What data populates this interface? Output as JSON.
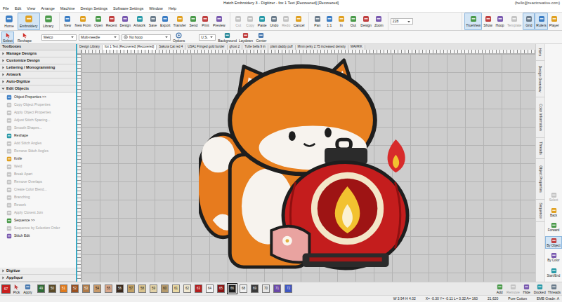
{
  "window": {
    "title": "Hatch Embroidery 3 - Digitizer - fox 1 Text [Recovered] [Recovered]",
    "account": "(hello@reactcreative.com)"
  },
  "menu": [
    "File",
    "Edit",
    "View",
    "Arrange",
    "Machine",
    "Design Settings",
    "Software Settings",
    "Window",
    "Help"
  ],
  "ribbon": {
    "modes": [
      {
        "label": "Home",
        "selected": false
      },
      {
        "label": "Embroidery",
        "selected": true
      },
      {
        "label": "Library",
        "selected": false
      }
    ],
    "groups": [
      [
        {
          "label": "New",
          "selected": false,
          "disabled": false
        },
        {
          "label": "New From",
          "selected": false,
          "disabled": false
        },
        {
          "label": "Open",
          "selected": false,
          "disabled": false
        },
        {
          "label": "Recent",
          "selected": false,
          "disabled": false
        },
        {
          "label": "Design",
          "selected": false,
          "disabled": false
        },
        {
          "label": "Artwork",
          "selected": false,
          "disabled": false
        },
        {
          "label": "Save",
          "selected": false,
          "disabled": false
        },
        {
          "label": "Export",
          "selected": false,
          "disabled": false
        },
        {
          "label": "Transfer",
          "selected": false,
          "disabled": false
        },
        {
          "label": "Send",
          "selected": false,
          "disabled": false
        },
        {
          "label": "Print",
          "selected": false,
          "disabled": false
        },
        {
          "label": "Preview",
          "selected": false,
          "disabled": false
        }
      ],
      [
        {
          "label": "Cut",
          "selected": false,
          "disabled": true
        },
        {
          "label": "Copy",
          "selected": false,
          "disabled": true
        },
        {
          "label": "Paste",
          "selected": false,
          "disabled": false
        },
        {
          "label": "Undo",
          "selected": false,
          "disabled": false
        },
        {
          "label": "Redo",
          "selected": false,
          "disabled": true
        },
        {
          "label": "Cancel",
          "selected": false,
          "disabled": false
        }
      ],
      [
        {
          "label": "Pan",
          "selected": false,
          "disabled": false
        },
        {
          "label": "1:1",
          "selected": false,
          "disabled": false
        },
        {
          "label": "In",
          "selected": false,
          "disabled": false
        },
        {
          "label": "Out",
          "selected": false,
          "disabled": false
        },
        {
          "label": "Design",
          "selected": false,
          "disabled": false
        },
        {
          "label": "Zoom",
          "selected": false,
          "disabled": false
        }
      ]
    ],
    "zoom": "228",
    "display": [
      {
        "label": "TrueView",
        "selected": true,
        "disabled": false
      },
      {
        "label": "Show",
        "selected": false,
        "disabled": false
      },
      {
        "label": "Hoop",
        "selected": false,
        "disabled": false
      },
      {
        "label": "Template",
        "selected": false,
        "disabled": true
      },
      {
        "label": "Grid",
        "selected": true,
        "disabled": false
      },
      {
        "label": "Rulers",
        "selected": true,
        "disabled": false
      },
      {
        "label": "Player",
        "selected": false,
        "disabled": false
      }
    ]
  },
  "toolbar": {
    "tools": [
      {
        "label": "Select",
        "selected": true
      },
      {
        "label": "Reshape",
        "selected": false
      }
    ],
    "machine": "Melco",
    "needle": "Multi-needle",
    "hoop": "No hoop",
    "options": "Options",
    "units": "U.S.",
    "view_tools": [
      "Background",
      "Laydown",
      "Center"
    ]
  },
  "doc_tabs": [
    {
      "label": "Design Library",
      "selected": false
    },
    {
      "label": "fox 1 Text [Recovered] [Recovered]",
      "selected": true
    },
    {
      "label": "Sakura Cat red 4",
      "selected": false
    },
    {
      "label": "USA1 Fringed gold border",
      "selected": false
    },
    {
      "label": "ghost 2",
      "selected": false
    },
    {
      "label": "Tufte bella 9 in",
      "selected": false
    },
    {
      "label": "plant daddy puff",
      "selected": false
    },
    {
      "label": "Mmm jerky 2.75 increased density",
      "selected": false
    },
    {
      "label": "MAVRIK",
      "selected": false
    }
  ],
  "toolbox": {
    "title": "Toolboxes",
    "sections": [
      {
        "label": "Manage Designs",
        "expanded": false,
        "items": []
      },
      {
        "label": "Customize Design",
        "expanded": false,
        "items": []
      },
      {
        "label": "Lettering / Monogramming",
        "expanded": false,
        "items": []
      },
      {
        "label": "Artwork",
        "expanded": false,
        "items": []
      },
      {
        "label": "Auto-Digitize",
        "expanded": false,
        "items": []
      },
      {
        "label": "Edit Objects",
        "expanded": true,
        "items": [
          {
            "label": "Object Properties >>",
            "disabled": false
          },
          {
            "label": "Copy Object Properties",
            "disabled": true
          },
          {
            "label": "Apply Object Properties",
            "disabled": true
          },
          {
            "label": "Adjust Stitch Spacing...",
            "disabled": true
          },
          {
            "label": "Smooth Shapes...",
            "disabled": true
          },
          {
            "label": "Reshape",
            "disabled": false
          },
          {
            "label": "Add Stitch Angles",
            "disabled": true
          },
          {
            "label": "Remove Stitch Angles",
            "disabled": true
          },
          {
            "label": "Knife",
            "disabled": false
          },
          {
            "label": "Weld",
            "disabled": true
          },
          {
            "label": "Break Apart",
            "disabled": true
          },
          {
            "label": "Remove Overlaps",
            "disabled": true
          },
          {
            "label": "Create Color Blend...",
            "disabled": true
          },
          {
            "label": "Branching",
            "disabled": true
          },
          {
            "label": "Rework",
            "disabled": true
          },
          {
            "label": "Apply Closest Join",
            "disabled": true
          },
          {
            "label": "Sequence >>",
            "disabled": false
          },
          {
            "label": "Sequence by Selection Order",
            "disabled": true
          },
          {
            "label": "Stitch Edit",
            "disabled": false
          }
        ]
      },
      {
        "label": "Digitize",
        "expanded": false,
        "items": []
      },
      {
        "label": "Appliqué",
        "expanded": false,
        "items": []
      }
    ]
  },
  "side_tabs": [
    "Hints",
    "Design Overview",
    "Color Information",
    "Threads",
    "Object Properties",
    "Sequence"
  ],
  "side_tools": [
    {
      "label": "Select",
      "selected": false,
      "disabled": true
    },
    {
      "label": "Back",
      "selected": false,
      "disabled": false
    },
    {
      "label": "Forward",
      "selected": false,
      "disabled": false
    },
    {
      "label": "By Object",
      "selected": true,
      "disabled": false
    },
    {
      "label": "By Color",
      "selected": false,
      "disabled": false
    },
    {
      "label": "Start/End",
      "selected": false,
      "disabled": false
    }
  ],
  "palette": {
    "current": {
      "label": "67",
      "color": "#c8201e"
    },
    "tools": [
      "Pick",
      "Apply"
    ],
    "swatches": [
      {
        "label": "49",
        "color": "#2f6a35",
        "selected": false
      },
      {
        "label": "50",
        "color": "#5a4a26",
        "selected": false
      },
      {
        "label": "51",
        "color": "#e07a1c",
        "selected": false
      },
      {
        "label": "52",
        "color": "#9a4f1e",
        "selected": false
      },
      {
        "label": "53",
        "color": "#b07a48",
        "selected": false
      },
      {
        "label": "54",
        "color": "#c89a6a",
        "selected": false
      },
      {
        "label": "55",
        "color": "#d9a88c",
        "selected": false
      },
      {
        "label": "56",
        "color": "#3b2a1e",
        "selected": false
      },
      {
        "label": "57",
        "color": "#c3a266",
        "selected": false
      },
      {
        "label": "58",
        "color": "#d9c38e",
        "selected": false
      },
      {
        "label": "59",
        "color": "#e3d3a8",
        "selected": false
      },
      {
        "label": "60",
        "color": "#b59a6c",
        "selected": false
      },
      {
        "label": "61",
        "color": "#ead9a4",
        "selected": false
      },
      {
        "label": "62",
        "color": "#f1e9d2",
        "selected": false
      },
      {
        "label": "63",
        "color": "#b51d1d",
        "selected": false
      },
      {
        "label": "64",
        "color": "#f5f5f5",
        "selected": false
      },
      {
        "label": "65",
        "color": "#8a1212",
        "selected": false
      },
      {
        "label": "66",
        "color": "#1c1c1c",
        "selected": true
      },
      {
        "label": "68",
        "color": "#f2f2f2",
        "selected": false
      },
      {
        "label": "69",
        "color": "#3a3a3a",
        "selected": false
      },
      {
        "label": "70",
        "color": "#e6e6e6",
        "selected": false
      },
      {
        "label": "71",
        "color": "#6a48a8",
        "selected": false
      },
      {
        "label": "72",
        "color": "#3f56c2",
        "selected": false
      }
    ],
    "actions": [
      {
        "label": "Add",
        "disabled": false
      },
      {
        "label": "Remove",
        "disabled": true
      },
      {
        "label": "Hide",
        "disabled": false
      },
      {
        "label": "Docked",
        "disabled": false
      },
      {
        "label": "Threads",
        "disabled": false
      }
    ]
  },
  "status_bar": [
    "W 3.94 H 4.02",
    "X= -0.30 Y= -0.11 L= 0.32 A= 160",
    "21,620",
    "Pure Cotton",
    "EMB Grade: A"
  ]
}
